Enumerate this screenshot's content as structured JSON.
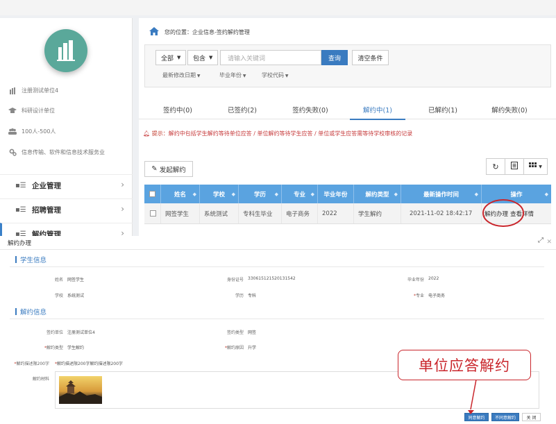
{
  "sidebar": {
    "info": [
      {
        "icon": "building-icon",
        "text": "注册测试单位4"
      },
      {
        "icon": "graduation-cap-icon",
        "text": "科研设计单位"
      },
      {
        "icon": "people-icon",
        "text": "100人-500人"
      },
      {
        "icon": "gear-icon",
        "text": "信息传输、软件和信息技术服务业"
      }
    ],
    "menu": [
      {
        "label": "企业管理"
      },
      {
        "label": "招聘管理"
      },
      {
        "label": "解约管理"
      }
    ]
  },
  "breadcrumb": "您的位置：企业信息-签约解约管理",
  "search": {
    "scope": "全部",
    "match": "包含",
    "placeholder": "请输入关键词",
    "query_label": "查询",
    "clear_label": "清空条件",
    "filters": [
      "最新修改日期",
      "毕业年份",
      "学校代码"
    ]
  },
  "tabs": [
    "签约中(0)",
    "已签约(2)",
    "签约失败(0)",
    "解约中(1)",
    "已解约(1)",
    "解约失败(0)"
  ],
  "tip": {
    "label": "提示：",
    "text": "解约中包括学生解约等待单位应答 / 单位解约等待学生应答 / 单位或学生应答需等待学校审核的记录"
  },
  "start_button": "发起解约",
  "table": {
    "headers": [
      "姓名",
      "学校",
      "学历",
      "专业",
      "毕业年份",
      "解约类型",
      "最新操作时间",
      "操作"
    ],
    "rows": [
      {
        "name": "网签学生",
        "school": "系统测试",
        "degree": "专科生毕业",
        "major": "电子商务",
        "year": "2022",
        "type": "学生解约",
        "time": "2021-11-02 18:42:17",
        "op1": "解约办理",
        "op2": "查看详情"
      }
    ]
  },
  "modal": {
    "title": "解约办理",
    "student_section": "学生信息",
    "student_fields": [
      {
        "label": "姓名",
        "value": "网签学生"
      },
      {
        "label": "身份证号",
        "value": "330615121520131542"
      },
      {
        "label": "毕业年份",
        "value": "2022"
      },
      {
        "label": "学校",
        "value": "系统测试"
      },
      {
        "label": "学历",
        "value": "专科"
      },
      {
        "label": "专业",
        "value": "电子商务"
      }
    ],
    "cancel_section": "解约信息",
    "cancel_fields": [
      {
        "label": "签约单位",
        "value": "注册测试单位4"
      },
      {
        "label": "签约类型",
        "value": "网签"
      },
      {
        "label": "解约类型",
        "value": "学生解约"
      },
      {
        "label": "解约原因",
        "value": "升学"
      }
    ],
    "desc_label": "解约描述限200字",
    "desc_value": "解约描述限200字解约描述限200字",
    "attach_label": "解约材料",
    "buttons": {
      "agree": "同意解约",
      "disagree": "不同意解约",
      "close": "关 闭"
    }
  },
  "annotation": {
    "callout": "单位应答解约",
    "color": "#c9252b"
  },
  "colors": {
    "accent": "#3a7bc0",
    "table_header": "#5aa3e0",
    "logo": "#5aa89a",
    "tip": "#c6393a"
  }
}
